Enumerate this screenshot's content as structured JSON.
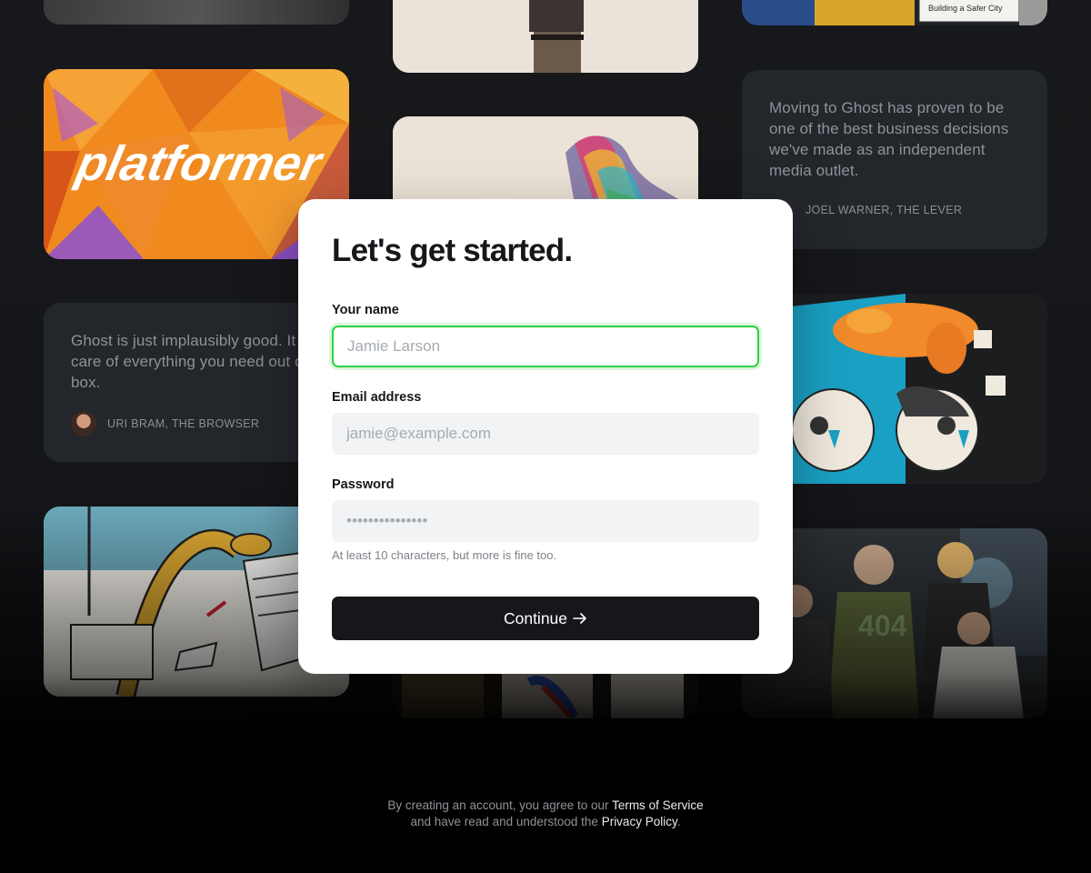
{
  "modal": {
    "title": "Let's get started.",
    "name_label": "Your name",
    "name_placeholder": "Jamie Larson",
    "email_label": "Email address",
    "email_placeholder": "jamie@example.com",
    "password_label": "Password",
    "password_placeholder": "•••••••••••••••",
    "password_hint": "At least 10 characters, but more is fine too.",
    "continue_label": "Continue",
    "continue_icon": "arrow-right-icon"
  },
  "testimonials": [
    {
      "text": "Moving to Ghost has proven to be one of the best business decisions we've made as an independent media outlet.",
      "author": "JOEL WARNER, THE LEVER"
    },
    {
      "text": "Ghost is just implausibly good. It takes care of everything you need out of the box.",
      "author": "URI BRAM, THE BROWSER"
    }
  ],
  "showcase": {
    "platformer_logo": "platformer",
    "sign_text": "VISION\nBuilding a Safer City",
    "badge_text": "404"
  },
  "footer": {
    "prefix": "By creating an account, you agree to our",
    "terms_link": "Terms of Service",
    "middle": "and have read and understood the",
    "privacy_link": "Privacy Policy",
    "suffix": "."
  },
  "colors": {
    "accent_focus": "#30cf43",
    "button_bg": "#15171a",
    "background": "#16181b"
  }
}
